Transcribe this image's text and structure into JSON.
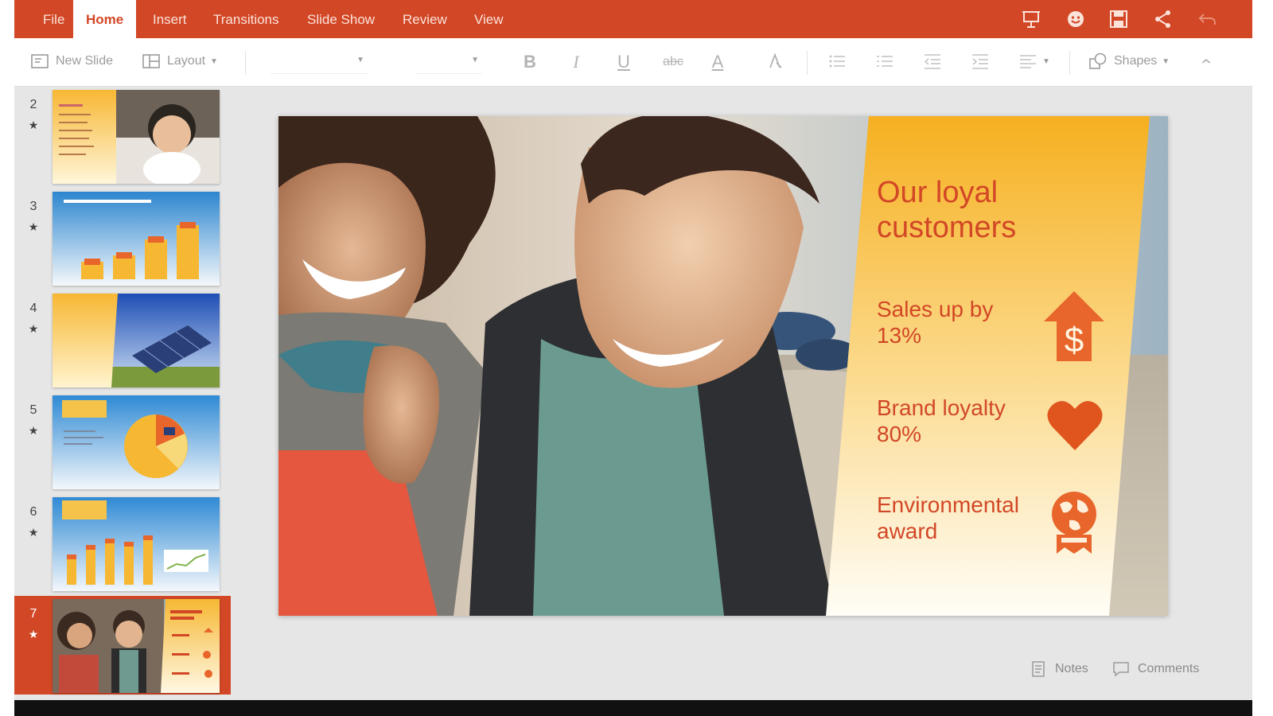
{
  "ribbon": {
    "tabs": [
      "File",
      "Home",
      "Insert",
      "Transitions",
      "Slide Show",
      "Review",
      "View"
    ],
    "active_tab": "Home",
    "accent": "#d24726",
    "right_icons": [
      "present-icon",
      "feedback-smiley-icon",
      "save-icon",
      "share-icon",
      "undo-icon"
    ]
  },
  "toolbar": {
    "new_slide": "New Slide",
    "layout": "Layout",
    "font_name": "",
    "font_size": "",
    "bold": "B",
    "italic": "I",
    "underline": "U",
    "strikethrough": "abc",
    "font_color": "A",
    "shapes": "Shapes"
  },
  "thumbnails": [
    {
      "number": "2",
      "star": "★"
    },
    {
      "number": "3",
      "star": "★"
    },
    {
      "number": "4",
      "star": "★"
    },
    {
      "number": "5",
      "star": "★"
    },
    {
      "number": "6",
      "star": "★"
    },
    {
      "number": "7",
      "star": "★",
      "selected": true
    }
  ],
  "slide": {
    "title": "Our loyal customers",
    "stats": [
      {
        "text": "Sales up by 13%",
        "icon": "dollar-up-arrow-icon"
      },
      {
        "text": "Brand loyalty 80%",
        "icon": "heart-icon"
      },
      {
        "text": "Environmental award",
        "icon": "globe-award-icon"
      }
    ]
  },
  "bottom": {
    "notes": "Notes",
    "comments": "Comments"
  }
}
